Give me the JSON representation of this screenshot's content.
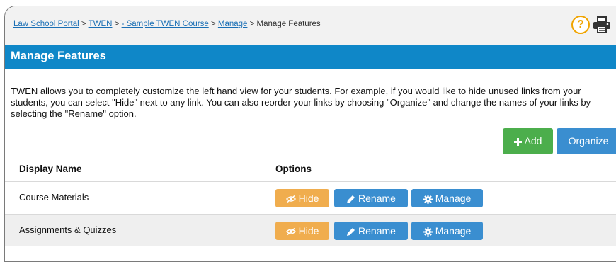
{
  "breadcrumb": {
    "items": [
      {
        "label": "Law School Portal",
        "link": true
      },
      {
        "label": "TWEN",
        "link": true
      },
      {
        "label": "- Sample TWEN Course",
        "link": true
      },
      {
        "label": "Manage",
        "link": true
      },
      {
        "label": "Manage Features",
        "link": false
      }
    ],
    "separator": ">"
  },
  "header": {
    "help_icon": "question-circle-icon",
    "print_icon": "printer-icon",
    "help_glyph": "?"
  },
  "page": {
    "title": "Manage Features",
    "description": "TWEN allows you to completely customize the left hand view for your students. For example, if you would like to hide unused links from your students, you can select \"Hide\" next to any link. You can also reorder your links by choosing \"Organize\" and change the names of your links by selecting the \"Rename\" option."
  },
  "toolbar": {
    "add_label": "Add",
    "organize_label": "Organize"
  },
  "table": {
    "columns": [
      "Display Name",
      "Options"
    ],
    "rows": [
      {
        "name": "Course Materials",
        "hide": "Hide",
        "rename": "Rename",
        "manage": "Manage"
      },
      {
        "name": "Assignments & Quizzes",
        "hide": "Hide",
        "rename": "Rename",
        "manage": "Manage"
      }
    ]
  },
  "colors": {
    "title_bar": "#0f87c8",
    "add_button": "#4cae4c",
    "primary_button": "#3a8ed0",
    "hide_button": "#f0ad4e",
    "help_icon": "#f0a400"
  }
}
